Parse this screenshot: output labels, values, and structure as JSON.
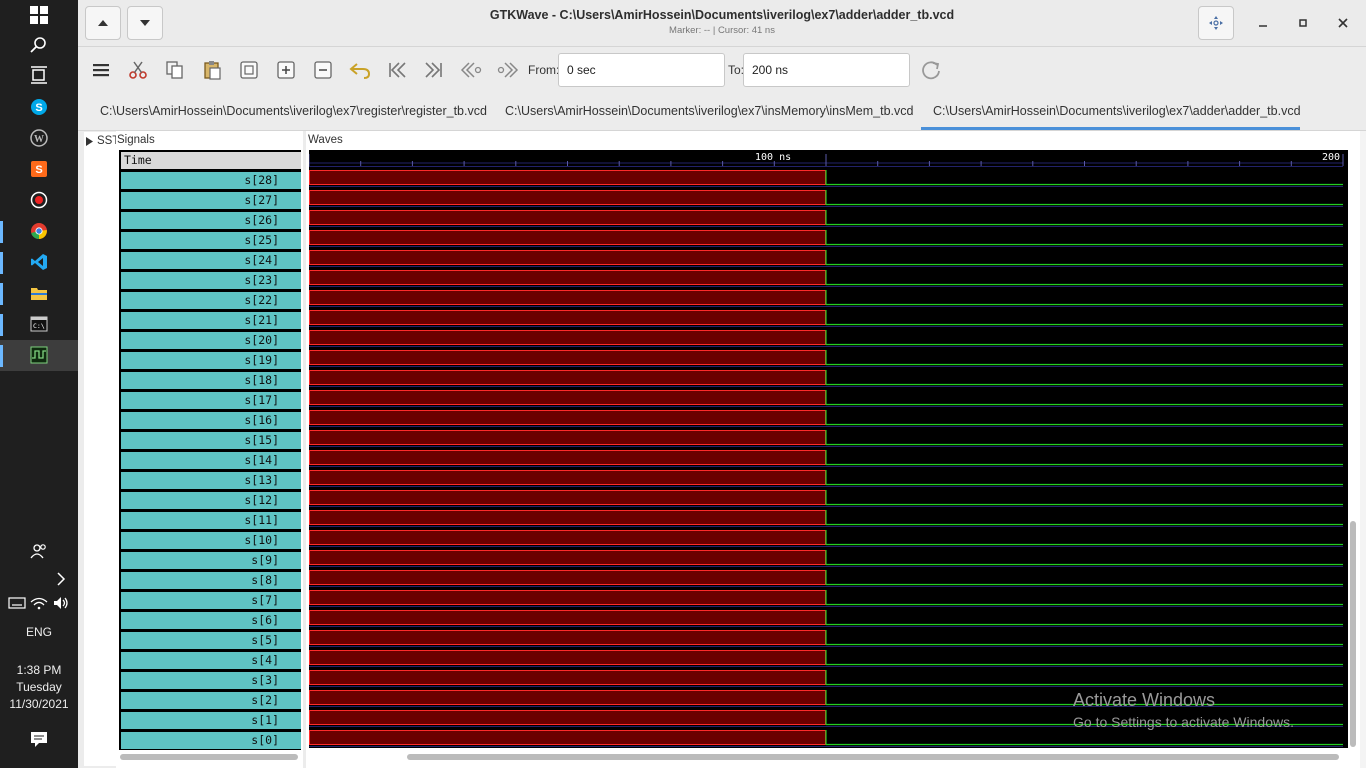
{
  "taskbar": {
    "icons": [
      "windows-start-icon",
      "search-icon",
      "task-view-icon",
      "skype-icon",
      "wordpress-icon",
      "sublime-text-icon",
      "record-icon",
      "chrome-icon",
      "vscode-icon",
      "file-explorer-icon",
      "command-prompt-icon",
      "gtkwave-icon"
    ],
    "people_icon": "people-icon",
    "chevron_icon": "chevron-right-icon",
    "tray_icons": [
      "keyboard-icon",
      "wifi-icon",
      "volume-icon"
    ],
    "language": "ENG",
    "time": "1:38 PM",
    "day": "Tuesday",
    "date": "11/30/2021",
    "notification_icon": "notification-icon"
  },
  "window": {
    "title": "GTKWave - C:\\Users\\AmirHossein\\Documents\\iverilog\\ex7\\adder\\adder_tb.vcd",
    "subtitle": "Marker: --  |  Cursor: 41 ns"
  },
  "toolbar": {
    "from_label": "From:",
    "from_value": "0 sec",
    "to_label": "To:",
    "to_value": "200 ns"
  },
  "tabs": [
    {
      "label": "C:\\Users\\AmirHossein\\Documents\\iverilog\\ex7\\register\\register_tb.vcd",
      "active": false
    },
    {
      "label": "C:\\Users\\AmirHossein\\Documents\\iverilog\\ex7\\insMemory\\insMem_tb.vcd",
      "active": false
    },
    {
      "label": "C:\\Users\\AmirHossein\\Documents\\iverilog\\ex7\\adder\\adder_tb.vcd",
      "active": true
    }
  ],
  "sst_label": "SST",
  "signals": {
    "label": "Signals",
    "time_row": "Time",
    "rows": [
      "s[28]",
      "s[27]",
      "s[26]",
      "s[25]",
      "s[24]",
      "s[23]",
      "s[22]",
      "s[21]",
      "s[20]",
      "s[19]",
      "s[18]",
      "s[17]",
      "s[16]",
      "s[15]",
      "s[14]",
      "s[13]",
      "s[12]",
      "s[11]",
      "s[10]",
      "s[9]",
      "s[8]",
      "s[7]",
      "s[6]",
      "s[5]",
      "s[4]",
      "s[3]",
      "s[2]",
      "s[1]",
      "s[0]"
    ]
  },
  "waves": {
    "label": "Waves",
    "tick_100": "100 ns",
    "tick_200": "200",
    "undefined_until_ns": 100,
    "total_ns": 200,
    "colors": {
      "background": "#000000",
      "undefined_fill": "#6b0000",
      "undefined_edge": "#ff2a2a",
      "logic_low": "#22cc22",
      "grid": "#22226a"
    }
  },
  "watermark": {
    "line1": "Activate Windows",
    "line2": "Go to Settings to activate Windows."
  }
}
